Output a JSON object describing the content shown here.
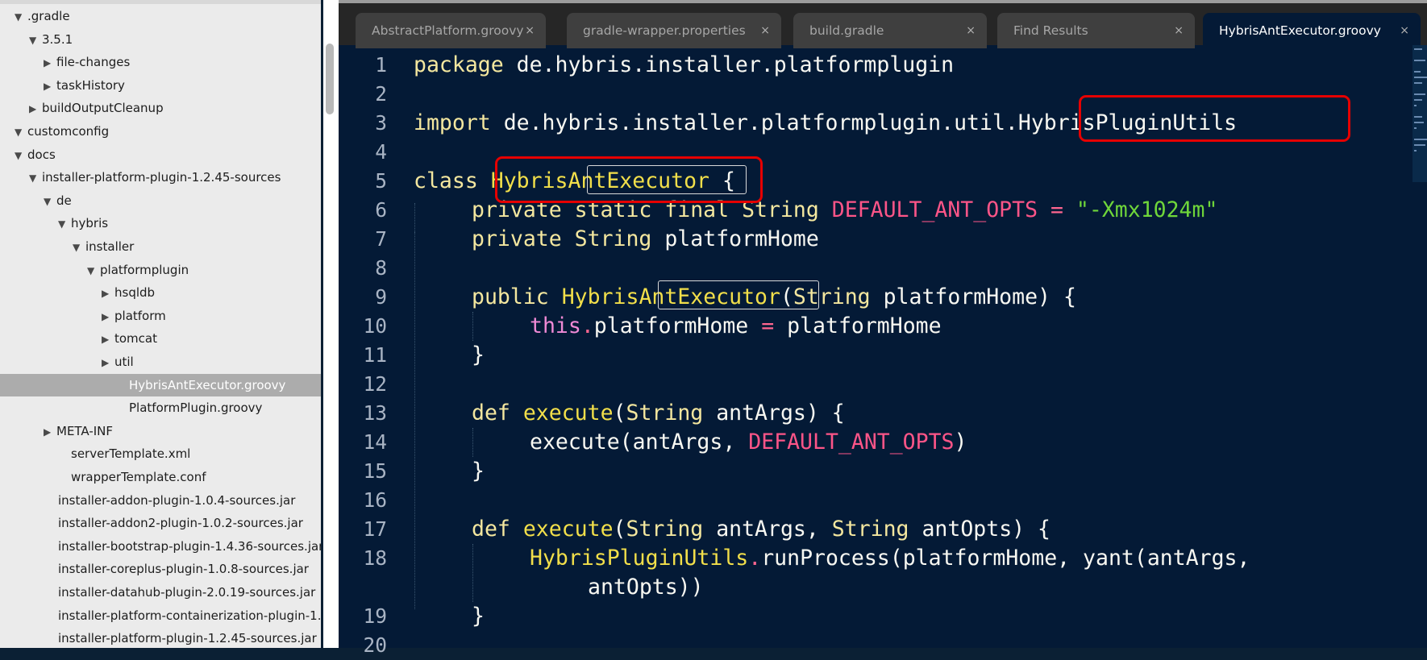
{
  "sidebar": {
    "items": [
      {
        "label": ".gradle",
        "expanded": true
      },
      {
        "label": "3.5.1",
        "expanded": true
      },
      {
        "label": "file-changes",
        "expanded": false
      },
      {
        "label": "taskHistory",
        "expanded": false
      },
      {
        "label": "buildOutputCleanup",
        "expanded": false
      },
      {
        "label": "customconfig",
        "expanded": true
      },
      {
        "label": "docs",
        "expanded": true
      },
      {
        "label": "installer-platform-plugin-1.2.45-sources",
        "expanded": true
      },
      {
        "label": "de",
        "expanded": true
      },
      {
        "label": "hybris",
        "expanded": true
      },
      {
        "label": "installer",
        "expanded": true
      },
      {
        "label": "platformplugin",
        "expanded": true
      },
      {
        "label": "hsqldb",
        "expanded": false
      },
      {
        "label": "platform",
        "expanded": false
      },
      {
        "label": "tomcat",
        "expanded": false
      },
      {
        "label": "util",
        "expanded": false
      },
      {
        "label": "HybrisAntExecutor.groovy",
        "selected": true
      },
      {
        "label": "PlatformPlugin.groovy"
      },
      {
        "label": "META-INF",
        "expanded": false
      },
      {
        "label": "serverTemplate.xml"
      },
      {
        "label": "wrapperTemplate.conf"
      },
      {
        "label": "installer-addon-plugin-1.0.4-sources.jar"
      },
      {
        "label": "installer-addon2-plugin-1.0.2-sources.jar"
      },
      {
        "label": "installer-bootstrap-plugin-1.4.36-sources.jar"
      },
      {
        "label": "installer-coreplus-plugin-1.0.8-sources.jar"
      },
      {
        "label": "installer-datahub-plugin-2.0.19-sources.jar"
      },
      {
        "label": "installer-platform-containerization-plugin-1."
      },
      {
        "label": "installer-platform-plugin-1.2.45-sources.jar"
      }
    ]
  },
  "tabs": [
    {
      "label": "AbstractPlatform.groovy",
      "close": "×"
    },
    {
      "label": "gradle-wrapper.properties",
      "close": "×"
    },
    {
      "label": "build.gradle",
      "close": "×"
    },
    {
      "label": "Find Results",
      "close": "×"
    },
    {
      "label": "HybrisAntExecutor.groovy",
      "close": "×",
      "active": true
    }
  ],
  "gutter": {
    "numbers": [
      "1",
      "2",
      "3",
      "4",
      "5",
      "6",
      "7",
      "8",
      "9",
      "10",
      "11",
      "12",
      "13",
      "14",
      "15",
      "16",
      "17",
      "18",
      "",
      "19",
      "20"
    ]
  },
  "code": {
    "l1": {
      "kw": "package",
      "rest": " de.hybris.installer.platformplugin"
    },
    "l3": {
      "kw": "import",
      "pre": " de.hybris.installer.platformplugin.util.",
      "cls": "HybrisPluginUtils"
    },
    "l5": {
      "kw": "class",
      "sp": " ",
      "a": "Hybris",
      "b": "AntExecutor",
      "brace": " {"
    },
    "l6": {
      "kw": "private static final",
      "sp": " ",
      "type": "String",
      "sp2": " ",
      "const": "DEFAULT_ANT_OPTS",
      "eq": " = ",
      "str": "\"-Xmx1024m\""
    },
    "l7": {
      "kw": "private",
      "sp": " ",
      "type": "String",
      "rest": " platformHome"
    },
    "l9": {
      "kw": "public",
      "sp": " ",
      "a": "Hybris",
      "b": "AntExecutor",
      "p1": "(",
      "type": "String",
      "p2": " platformHome) {"
    },
    "l10": {
      "this": "this",
      "dot": ".",
      "field": "platformHome",
      "eq": " = ",
      "rest": "platformHome"
    },
    "l11": "}",
    "l13": {
      "kw": "def",
      "sp": " ",
      "fn": "execute",
      "p1": "(",
      "type": "String",
      "p2": " antArgs) {"
    },
    "l14": {
      "pre": "execute(antArgs, ",
      "const": "DEFAULT_ANT_OPTS",
      "post": ")"
    },
    "l15": "}",
    "l17": {
      "kw": "def",
      "sp": " ",
      "fn": "execute",
      "p1": "(",
      "type": "String",
      "p2": " antArgs, ",
      "type2": "String",
      "p3": " antOpts) {"
    },
    "l18": {
      "cls": "HybrisPluginUtils",
      "dot": ".",
      "rest": "runProcess(platformHome, yant(antArgs,"
    },
    "l18b": "antOpts))",
    "l19": "}"
  },
  "colors": {
    "editor_bg": "#041a36",
    "sidebar_bg": "#ebebeb",
    "highlight_box": "#e60000",
    "keyword": "#f4e79f",
    "constant": "#fe5588",
    "string": "#6fd63a"
  }
}
